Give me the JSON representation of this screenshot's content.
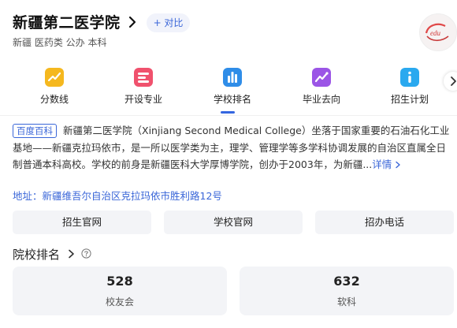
{
  "header": {
    "school_name": "新疆第二医学院",
    "compare_button": "+ 对比",
    "tags": "新疆 医药类 公办 本科",
    "logo_icon": "school-logo-icon"
  },
  "nav": {
    "items": [
      {
        "label": "分数线",
        "icon": "score-line-icon",
        "color": "#f5b81f"
      },
      {
        "label": "开设专业",
        "icon": "majors-icon",
        "color": "#f0516d"
      },
      {
        "label": "学校排名",
        "icon": "ranking-chart-icon",
        "color": "#2f8de8"
      },
      {
        "label": "毕业去向",
        "icon": "graduation-trend-icon",
        "color": "#9b55e6"
      },
      {
        "label": "招生计划",
        "icon": "info-icon",
        "color": "#2aa9ef"
      }
    ],
    "active_index": 2,
    "accent_color": "#3466e0"
  },
  "description": {
    "badge": "百度百科",
    "text": "新疆第二医学院（Xinjiang Second Medical College）坐落于国家重要的石油石化工业基地——新疆克拉玛依市，是一所以医学类为主，理学、管理学等多学科协调发展的自治区直属全日制普通本科高校。学校的前身是新疆医科大学厚博学院，创办于2003年，为新疆...",
    "more_link": "详情"
  },
  "address": "地址：新疆维吾尔自治区克拉玛依市胜利路12号",
  "links": [
    "招生官网",
    "学校官网",
    "招办电话"
  ],
  "ranking": {
    "title": "院校排名",
    "cards": [
      {
        "value": "528",
        "label": "校友会"
      },
      {
        "value": "632",
        "label": "软科"
      }
    ]
  }
}
